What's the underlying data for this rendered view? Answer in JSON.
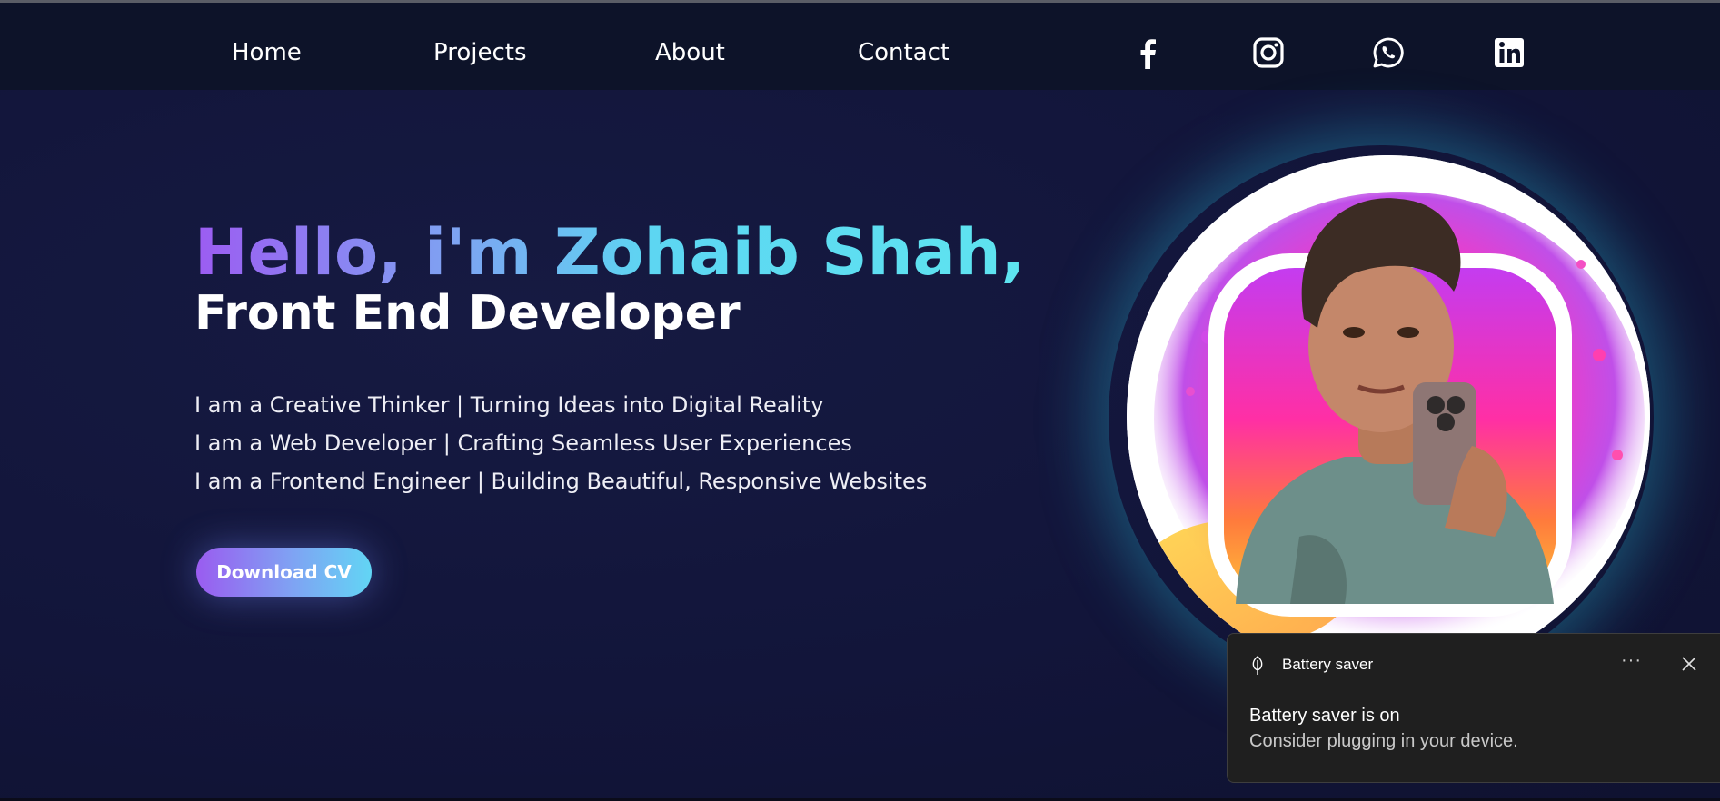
{
  "nav": {
    "links": [
      "Home",
      "Projects",
      "About",
      "Contact"
    ],
    "social_icons": [
      "facebook-icon",
      "instagram-icon",
      "whatsapp-icon",
      "linkedin-icon"
    ]
  },
  "hero": {
    "greeting": "Hello, i'm Zohaib Shah,",
    "role": "Front End Developer",
    "taglines": [
      "I am a Creative Thinker | Turning Ideas into Digital Reality",
      "I am a Web Developer | Crafting Seamless User Experiences",
      "I am a Frontend Engineer | Building Beautiful, Responsive Websites"
    ],
    "cta_label": "Download CV",
    "portrait_icon": "profile-portrait-image"
  },
  "toast": {
    "app_name": "Battery saver",
    "app_icon": "battery-saver-leaf-icon",
    "more_label": "···",
    "title": "Battery saver is on",
    "body": "Consider plugging in your device."
  },
  "colors": {
    "background": "#131638",
    "nav_background": "#0d1329",
    "gradient_start": "#9c5cf2",
    "gradient_end": "#5ee4f0",
    "toast_background": "#1f1f1f"
  }
}
